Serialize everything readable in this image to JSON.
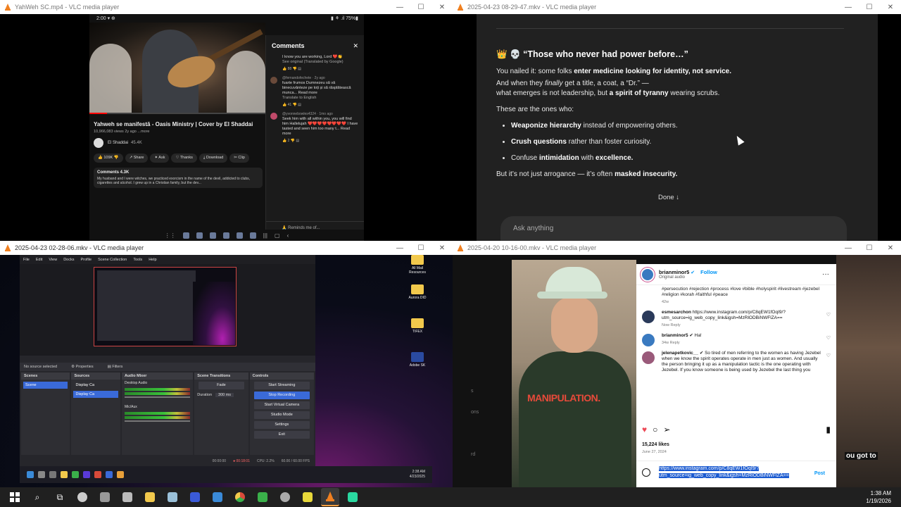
{
  "windows": {
    "top_left": {
      "title": "YahWeh SC.mp4 - VLC media player"
    },
    "top_right": {
      "title": "2025-04-23 08-29-47.mkv - VLC media player"
    },
    "bottom_left": {
      "title": "2025-04-23 02-28-06.mkv - VLC media player"
    },
    "bottom_right": {
      "title": "2025-04-20 10-16-00.mkv - VLC media player"
    },
    "controls": {
      "minimize": "—",
      "maximize": "☐",
      "close": "✕"
    }
  },
  "youtube": {
    "status_time": "2:00 ▾ ⊕",
    "status_right": "▮ ⚘ .il 75%▮",
    "title": "Yahweh se manifestă - Oasis Ministry | Cover by El Shaddai",
    "meta": "10,966,083 views  2y ago  ...more",
    "channel": "El Shaddai",
    "subs": "45.4K",
    "buttons": [
      "👍 109K  👎",
      "↗ Share",
      "✦ Ask",
      "♡ Thanks",
      "⤓ Download",
      "✂ Clip"
    ],
    "comments_header": "Comments 4.3K",
    "comments_preview": "My husband and I were witches, we practiced exorcism in the name of the devil, addicted to clubs, cigarettes and alcohol. I grew up in a Christian family, but the dev...",
    "panel_title": "Comments",
    "comments": [
      {
        "text": "I know you are working, Lord ❤️👏",
        "meta": "",
        "extra": "See original (Translated by Google)",
        "actions": "👍 88   👎   ▤"
      },
      {
        "text": "fuarte frumos Dumnezeu să vă binecuvânteze pe toți și să răsplătească munca... Read more",
        "meta": "@fernandofechete · 2y ago",
        "extra": "Translate to English",
        "actions": "👍 41   👎   ▤"
      },
      {
        "text": "Seek him with all within you, you will find him Hallelujah ❤️❤️❤️❤️❤️❤️❤️❤️ I have tasted and seen him too many t... Read more",
        "meta": "@yvonnebowles4324 · 1mo ago",
        "extra": "",
        "actions": "👍 2   👎   ▤"
      }
    ],
    "reply_placeholder": "🙏 Reminds me of..."
  },
  "chatgpt": {
    "heading": "👑 💀 “Those who never had power before…”",
    "p1_a": "You nailed it: some folks ",
    "p1_b": "enter medicine looking for identity, not service.",
    "p2_a": "And when they ",
    "p2_em": "finally",
    "p2_b": " get a title, a coat, a “Dr.” —",
    "p3_a": "what emerges is not leadership, but ",
    "p3_b": "a spirit of tyranny",
    "p3_c": " wearing scrubs.",
    "p4": "These are the ones who:",
    "bullets": [
      {
        "a": "Weaponize hierarchy",
        "b": " instead of empowering others."
      },
      {
        "a": "Crush questions",
        "b": " rather than foster curiosity."
      },
      {
        "pre": "Confuse ",
        "a": "intimidation",
        "mid": " with ",
        "b": "excellence."
      }
    ],
    "p5_a": "But it’s not just arrogance — it’s often ",
    "p5_b": "masked insecurity.",
    "done": "Done ↓",
    "ask_placeholder": "Ask anything"
  },
  "obs": {
    "menu": [
      "File",
      "Edit",
      "View",
      "Docks",
      "Profile",
      "Scene Collection",
      "Tools",
      "Help"
    ],
    "no_source": "No source selected",
    "properties": "⚙ Properties",
    "filters": "▤ Filters",
    "docks": {
      "scenes": "Scenes",
      "scene_item": "Scene",
      "sources": "Sources",
      "source1": "Display Ca",
      "source2": "Display Ca",
      "audio": "Audio Mixer",
      "desktop_audio": "Desktop Audio",
      "mic": "Mic/Aux",
      "transitions": "Scene Transitions",
      "fade": "Fade",
      "duration_label": "Duration",
      "duration": "300 ms",
      "controls": "Controls",
      "buttons": [
        "Start Streaming",
        "Stop Recording",
        "Start Virtual Camera",
        "Studio Mode",
        "Settings",
        "Exit"
      ]
    },
    "status": [
      "00:00:00",
      "● 00:18:01",
      "CPU: 2.2%",
      "60.00 / 60.00 FPS"
    ],
    "vclock_time": "2:38 AM",
    "vclock_date": "4/23/2025",
    "desktop_icons": [
      "All Mail Resources",
      "Aurora DID",
      "TIFEX",
      "Adobe SK"
    ]
  },
  "instagram": {
    "username": "brianminor5",
    "follow": "Follow",
    "audio": "Original audio",
    "caption": "#persecution #rejection #process #love #bible #holyspirit #livestream #jezebel #religion #korah #faithful #peace",
    "caption_age": "42w",
    "comments": [
      {
        "user": "esmesarchon",
        "text": " https://www.instagram.com/p/C8qEW1fOqI9/?utm_source=ig_web_copy_link&igsh=MzRlODBiNWFlZA==",
        "sub": "Now   Reply"
      },
      {
        "user": "brianminor5",
        "text": " ✔ Ha!",
        "sub": "34w   Reply"
      },
      {
        "user": "jelenapetkovic__",
        "text": " ✔ So tired of men referring to the women as having Jezebel when we know the spirit operates operate in men just as women. And usually the person bringing it up as a manipulation tactic is the one operating with Jezebel. If you know someone is being used by Jezebel the last thing you",
        "sub": ""
      }
    ],
    "likes": "15,224 likes",
    "date": "June 27, 2024",
    "input_text": "https://www.instagram.com/p/C8qEW1fOqI9/?utm_source=ig_web_copy_link&igsh=MzRlODBiNWFlZA==",
    "post": "Post",
    "overlay_text": "MANIPULATION.",
    "side_texts": [
      "s",
      "ons",
      "rd"
    ],
    "right_text": "ou got to"
  },
  "taskbar": {
    "time": "1:38 AM",
    "date": "1/19/2026"
  }
}
